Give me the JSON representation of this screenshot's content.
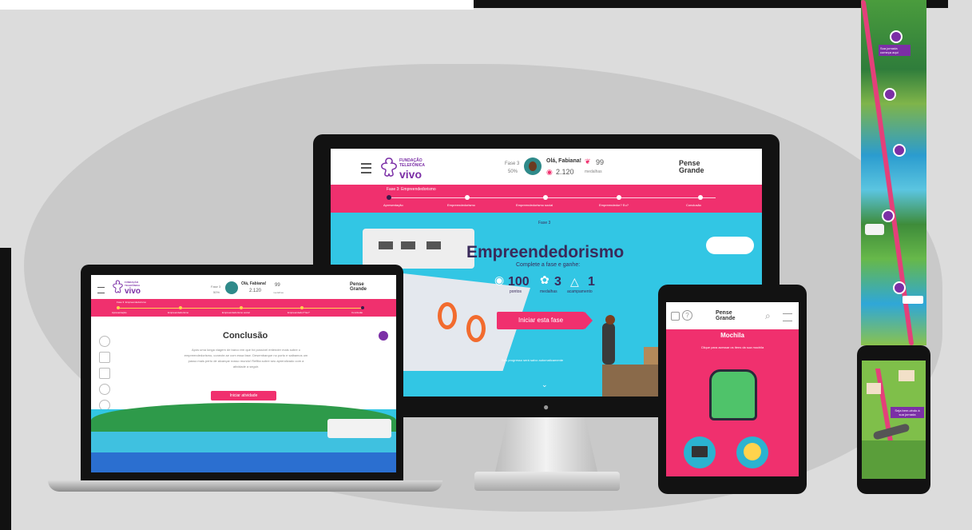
{
  "monitor": {
    "logo": {
      "line1": "FUNDAÇÃO",
      "line2": "TELEFÔNICA",
      "brand": "vivo"
    },
    "user": {
      "phase": "Fase 3",
      "percent": "50%",
      "greeting": "Olá, Fabiana!",
      "points": "2.120",
      "medals": "99",
      "medals_label": "medalhas"
    },
    "partner_logo": "Pense Grande",
    "phase_label": "Fase 3: Empreendedorismo",
    "steps": [
      "Apresentação",
      "Empreendedorismo",
      "Empreendedorismo social",
      "Empreendedor? Eu?",
      "Conclusão"
    ],
    "small_tag": "Fase 3",
    "title": "Empreendedorismo",
    "subtitle": "Complete a fase e ganhe:",
    "rewards": [
      {
        "value": "100",
        "label": "pontos"
      },
      {
        "value": "3",
        "label": "medalhas"
      },
      {
        "value": "1",
        "label": "acampamento"
      }
    ],
    "cta": "Iniciar esta fase",
    "footer_note": "Seu progresso será salvo automaticamente"
  },
  "laptop": {
    "logo": {
      "line1": "FUNDAÇÃO",
      "line2": "TELEFÔNICA",
      "brand": "vivo"
    },
    "user": {
      "phase": "Fase 3",
      "percent": "50%",
      "greeting": "Olá, Fabiana!",
      "points": "2.120",
      "medals": "99",
      "medals_label": "medalhas"
    },
    "partner_logo": "Pense Grande",
    "phase_label": "Fase 3: Empreendedorismo",
    "steps": [
      "Apresentação",
      "Empreendedorismo",
      "Empreendedorismo social",
      "Empreendedor? Eu?",
      "Conclusão"
    ],
    "title": "Conclusão",
    "body": "Após uma longa viagem de barco em que foi possível entender mais sobre o empreendedorismo, conecte-se com essa fase. Desembarque no porto e saibamos um passo mais perto de alcançar nosso mundo! Reflita sobre seu aprendizado com a atividade a seguir.",
    "cta": "Iniciar atividade"
  },
  "tablet": {
    "partner_logo": "Pense Grande",
    "title": "Mochila",
    "subtitle": "Clique para acessar os itens da sua mochila"
  },
  "phone": {
    "sign": "Seja bem-vindo à sua jornada"
  },
  "strip": {
    "signs": [
      "Sua jornada começa aqui"
    ],
    "markers": [
      "01",
      "02",
      "03",
      "04"
    ]
  },
  "colors": {
    "accent": "#f0306e",
    "brand": "#7b2fa6",
    "sky": "#32c6e4"
  }
}
